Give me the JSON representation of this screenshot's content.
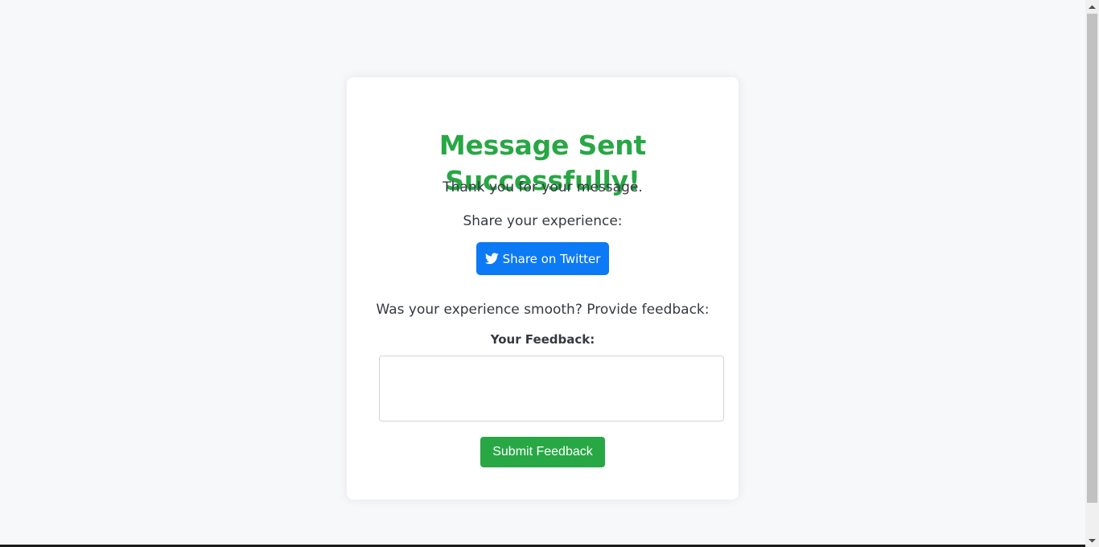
{
  "page": {
    "title": "Message Sent Successfully!",
    "thanks_text": "Thank you for your message.",
    "share_prompt": "Share your experience:",
    "twitter_button_label": "Share on Twitter",
    "twitter_icon": "twitter-bird-icon",
    "feedback_question": "Was your experience smooth? Provide feedback:",
    "feedback_label": "Your Feedback:",
    "feedback_value": "",
    "submit_label": "Submit Feedback"
  },
  "colors": {
    "success_green": "#28a745",
    "twitter_blue": "#0d7af5",
    "background": "#f7f8fa"
  }
}
